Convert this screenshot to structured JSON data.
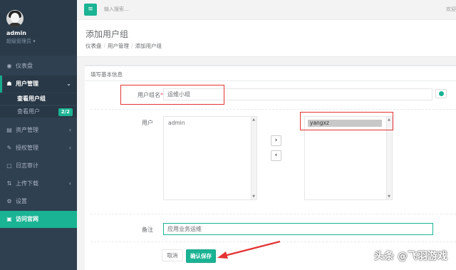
{
  "sidebar": {
    "user": {
      "name": "admin",
      "role": "超级管理员 ▾"
    },
    "items": [
      {
        "label": "仪表盘",
        "icon": "dashboard-icon",
        "glyph": "◉"
      },
      {
        "label": "用户管理",
        "icon": "users-icon",
        "glyph": "☗",
        "chev": "⌄"
      },
      {
        "label": "资产管理",
        "icon": "server-icon",
        "glyph": "▤",
        "chev": "‹"
      },
      {
        "label": "授权管理",
        "icon": "edit-icon",
        "glyph": "✎",
        "chev": "‹"
      },
      {
        "label": "日志审计",
        "icon": "log-icon",
        "glyph": "▢"
      },
      {
        "label": "上传下载",
        "icon": "upload-icon",
        "glyph": "⇅",
        "chev": "‹"
      },
      {
        "label": "设置",
        "icon": "gear-icon",
        "glyph": "⚙"
      },
      {
        "label": "访问官网",
        "icon": "file-icon",
        "glyph": "▣"
      }
    ],
    "sub_items": [
      {
        "label": "查看用户组"
      },
      {
        "label": "查看用户",
        "badge": "2/2"
      }
    ]
  },
  "topbar": {
    "menu_glyph": "≡",
    "search_placeholder": "输入搜索...",
    "welcome": "欢迎"
  },
  "header": {
    "title": "添加用户组",
    "breadcrumb": [
      "仪表盘",
      "用户管理",
      "添加用户组"
    ],
    "sep": "/"
  },
  "form": {
    "section_title": "填写基本信息",
    "group_name_label": "用户组名",
    "required_mark": "*",
    "group_name_value": "运维小组",
    "users_label": "用户",
    "available_users": [
      "admin"
    ],
    "selected_users": [
      "yangxz"
    ],
    "move_right": "›",
    "move_left": "‹",
    "note_label": "备注",
    "note_value": "应用业务运维",
    "cancel_label": "取消",
    "save_label": "确认保存"
  },
  "watermark": "头条 @飞羽游戏",
  "colors": {
    "accent": "#1ab394",
    "sidebar": "#2f4050",
    "highlight": "#e53333"
  }
}
